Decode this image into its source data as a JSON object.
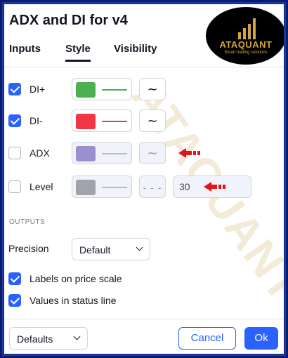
{
  "dialog": {
    "title": "ADX and DI for v4"
  },
  "logo": {
    "brand": "ATAQUANT",
    "tagline": "Smart trading solutions"
  },
  "watermark": {
    "text": "ATAQUANT"
  },
  "tabs": [
    {
      "label": "Inputs",
      "active": false
    },
    {
      "label": "Style",
      "active": true
    },
    {
      "label": "Visibility",
      "active": false
    }
  ],
  "rows": [
    {
      "label": "DI+",
      "checked": true,
      "color": "#4caf50",
      "style_icon": "line-style-wave-icon"
    },
    {
      "label": "DI-",
      "checked": true,
      "color": "#f23645",
      "style_icon": "line-style-wave-icon"
    },
    {
      "label": "ADX",
      "checked": false,
      "color": "#9c8fd0",
      "style_icon": "line-style-wave-icon"
    },
    {
      "label": "Level",
      "checked": false,
      "color": "#a0a3ab",
      "style_icon": "dashed-line-icon",
      "value": "30"
    }
  ],
  "outputs": {
    "section_label": "OUTPUTS",
    "precision_label": "Precision",
    "precision_value": "Default",
    "labels_on_price_scale": {
      "label": "Labels on price scale",
      "checked": true
    },
    "values_in_status_line": {
      "label": "Values in status line",
      "checked": true
    }
  },
  "footer": {
    "defaults_label": "Defaults",
    "cancel_label": "Cancel",
    "ok_label": "Ok"
  },
  "colors": {
    "accent": "#2962ff",
    "annotation_arrow": "#e0151a",
    "background": "#0a1d6b"
  }
}
